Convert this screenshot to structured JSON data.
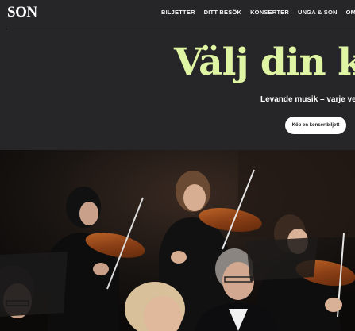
{
  "logo": {
    "text": "SON"
  },
  "nav": {
    "items": [
      {
        "label": "BILJETTER"
      },
      {
        "label": "DITT BESÖK"
      },
      {
        "label": "KONSERTER"
      },
      {
        "label": "UNGA & SON"
      },
      {
        "label": "OM OSS"
      }
    ]
  },
  "hero": {
    "title": "Välj din ko",
    "subtitle": "Levande musik – varje ve",
    "cta_label": "Köp en konsertbiljett"
  },
  "colors": {
    "background": "#262628",
    "accent": "#dff5a3",
    "button": "#ffffff"
  },
  "video": {
    "description_icon": "orchestra-video-image"
  }
}
